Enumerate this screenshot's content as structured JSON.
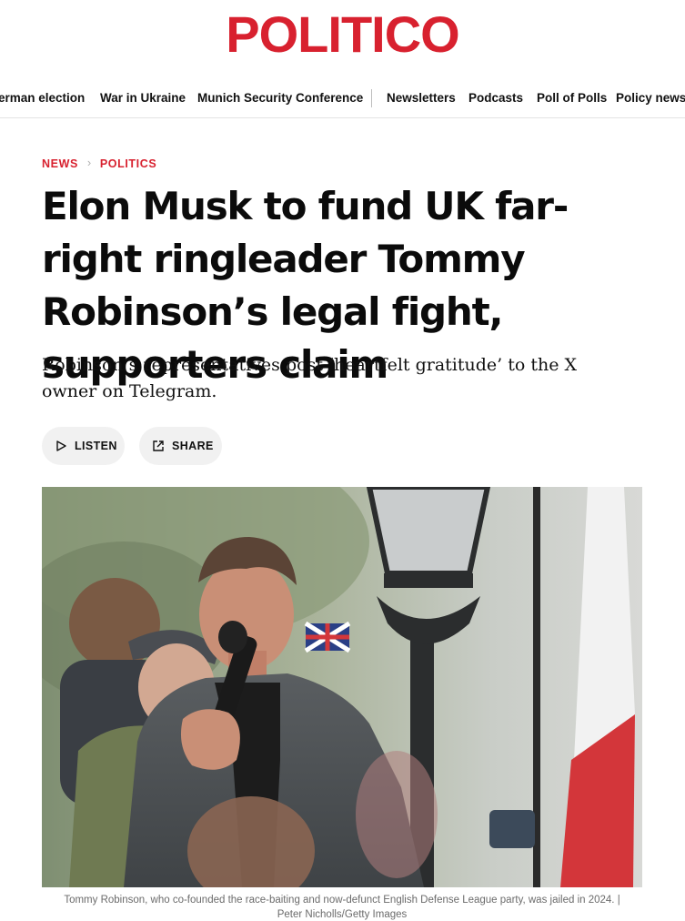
{
  "masthead": {
    "logo_text": "POLITICO"
  },
  "topnav": {
    "items": [
      "erman election",
      "War in Ukraine",
      "Munich Security Conference",
      "Newsletters",
      "Podcasts",
      "Poll of Polls",
      "Policy news"
    ]
  },
  "breadcrumb": {
    "section": "NEWS",
    "subsection": "POLITICS"
  },
  "article": {
    "headline": "Elon Musk to fund UK far-right ringleader Tommy Robinson’s legal fight, supporters claim",
    "dek": "Robinson’s representatives post ‘heartfelt gratitude’ to the X owner on Telegram.",
    "listen_label": "LISTEN",
    "share_label": "SHARE",
    "caption_line1": "Tommy Robinson, who co-founded the race-baiting and now-defunct English Defense League party, was jailed in 2024. |",
    "caption_line2": "Peter Nicholls/Getty Images"
  },
  "colors": {
    "brand_red": "#d8212f",
    "pill_bg": "#f1f1f1",
    "caption_gray": "#6b6b6b"
  },
  "icons": {
    "listen": "play-triangle-icon",
    "share": "share-arrow-icon"
  }
}
